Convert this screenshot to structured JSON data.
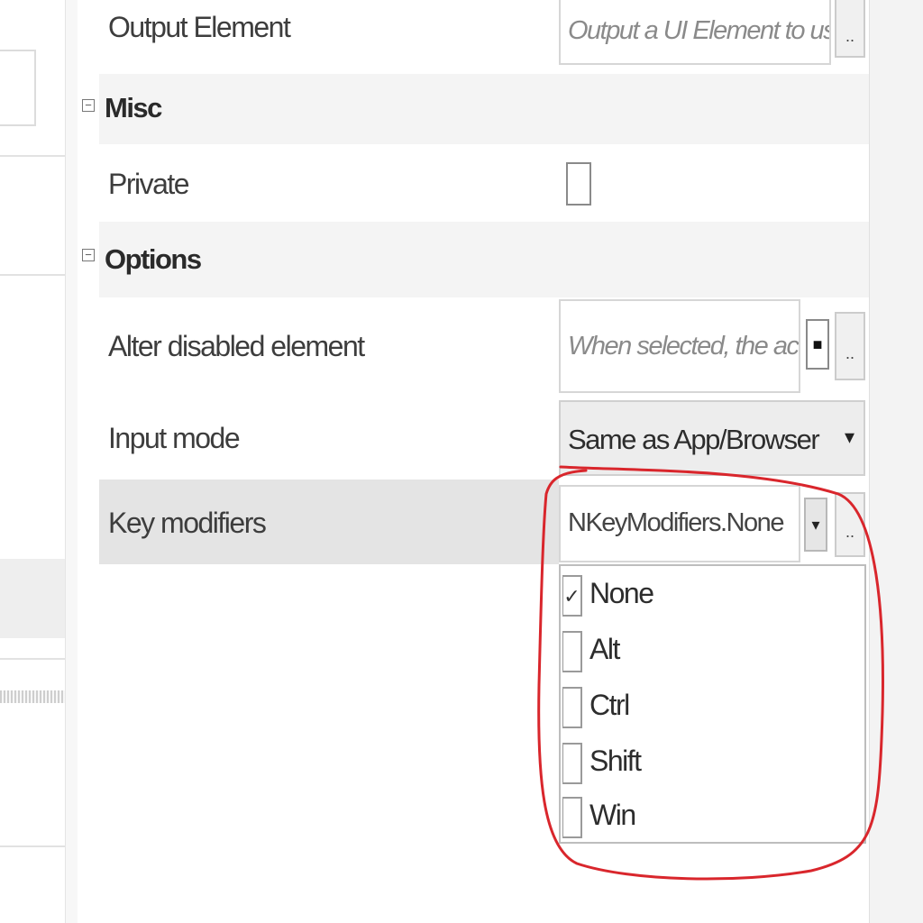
{
  "properties": {
    "output_element": {
      "label": "Output Element",
      "placeholder": "Output a UI Element to use in",
      "button_label": ".."
    },
    "misc_category": {
      "label": "Misc",
      "private": {
        "label": "Private",
        "checked": false
      }
    },
    "options_category": {
      "label": "Options",
      "alter_disabled_element": {
        "label": "Alter disabled element",
        "placeholder": "When selected, the activity",
        "indicator": "■",
        "button_label": ".."
      },
      "input_mode": {
        "label": "Input mode",
        "value": "Same as App/Browser",
        "arrow": "▾"
      },
      "key_modifiers": {
        "label": "Key modifiers",
        "value": "NKeyModifiers.None",
        "arrow": "▾",
        "button_label": ".."
      }
    },
    "expander_glyph": "−"
  },
  "key_modifiers_dropdown": {
    "items": [
      {
        "label": "None",
        "checked": true,
        "mark": "✓"
      },
      {
        "label": "Alt",
        "checked": false,
        "mark": ""
      },
      {
        "label": "Ctrl",
        "checked": false,
        "mark": ""
      },
      {
        "label": "Shift",
        "checked": false,
        "mark": ""
      },
      {
        "label": "Win",
        "checked": false,
        "mark": ""
      }
    ]
  },
  "colors": {
    "highlight_circle": "#d9262c",
    "selected_row": "#e4e4e4",
    "category_shade": "#f4f4f4"
  },
  "icons": {
    "expander": "minus-square-icon",
    "dropdown": "chevron-down-icon",
    "check": "check-icon"
  }
}
